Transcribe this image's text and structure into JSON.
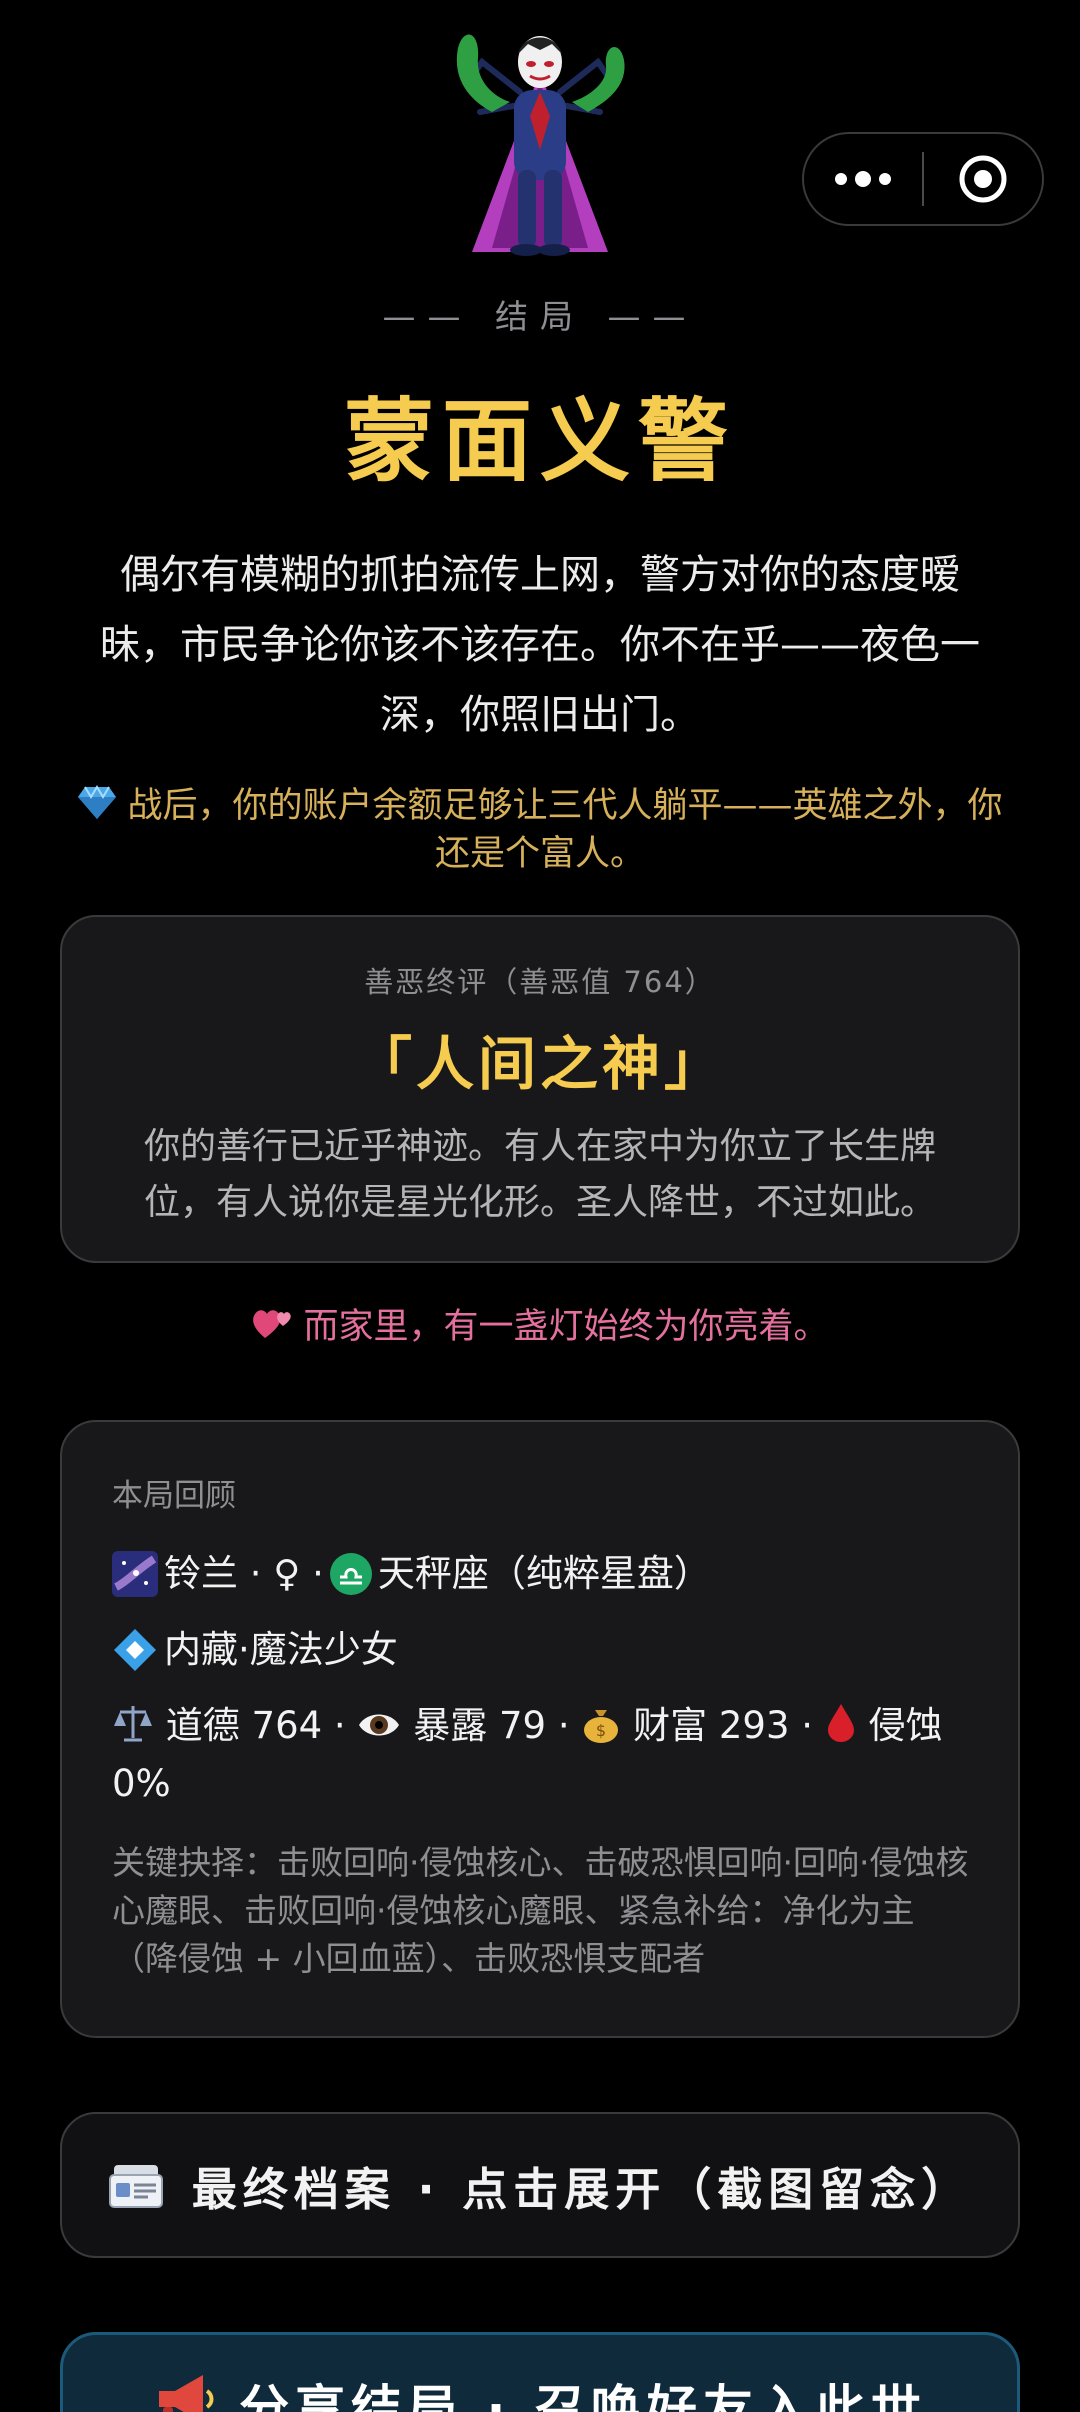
{
  "capsule": {
    "more_icon": "more-dots-icon",
    "close_icon": "target-close-icon"
  },
  "hero": {
    "icon": "supervillain-emoji"
  },
  "ending": {
    "tag": "—— 结局 ——",
    "title": "蒙面义警",
    "description": "偶尔有模糊的抓拍流传上网，警方对你的态度暧昧，市民争论你该不该存在。你不在乎——夜色一深，你照旧出门。",
    "wealth_note": "战后，你的账户余额足够让三代人躺平——英雄之外，你还是个富人。",
    "wealth_icon": "gem-icon"
  },
  "karma": {
    "label": "善恶终评（善恶值 764）",
    "title": "「人间之神」",
    "description": "你的善行已近乎神迹。有人在家中为你立了长生牌位，有人说你是星光化形。圣人降世，不过如此。"
  },
  "family": {
    "text": "而家里，有一盏灯始终为你亮着。",
    "icon": "two-hearts-icon"
  },
  "review": {
    "label": "本局回顾",
    "identity": "铃兰 · ♀ · ",
    "zodiac": "天秤座（纯粹星盘）",
    "hidden": "内藏·魔法少女",
    "stats": {
      "morality": "道德 764",
      "exposure": "暴露 79",
      "wealth": "财富 293",
      "corrosion_label": "侵蚀",
      "corrosion_value": "0%",
      "sep": " · "
    },
    "key_choices": "关键抉择：击败回响·侵蚀核心、击破恐惧回响·回响·侵蚀核心魔眼、击败回响·侵蚀核心魔眼、紧急补给：净化为主（降侵蚀 + 小回血蓝）、击败恐惧支配者"
  },
  "archive_button": {
    "label": "最终档案 · 点击展开（截图留念）",
    "icon": "card-file-icon"
  },
  "share_button": {
    "label": "分享结局 · 召唤好友入此世",
    "icon": "megaphone-icon"
  },
  "colors": {
    "gold": "#f5cc4f",
    "pink": "#e4709e",
    "wealth_gold": "#d6b05a",
    "card_bg": "#18181a",
    "share_bg": "#0f2a3a"
  }
}
